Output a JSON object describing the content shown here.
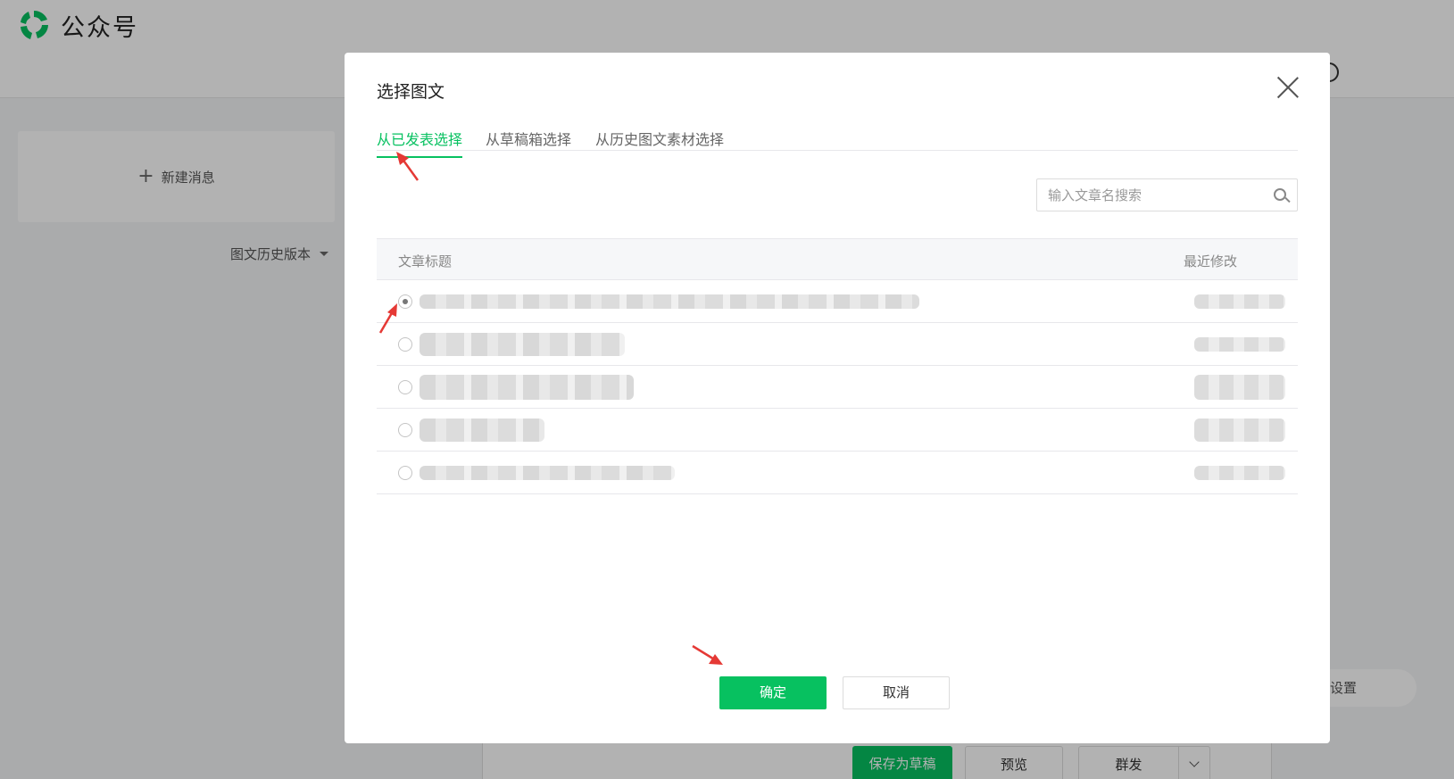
{
  "app": {
    "name": "公众号",
    "brand_color": "#07c160"
  },
  "sidebar": {
    "new_message_label": "新建消息",
    "history_version_label": "图文历史版本"
  },
  "background_actions": {
    "settings_label": "设置",
    "save_draft_label": "保存为草稿",
    "preview_label": "预览",
    "send_label": "群发"
  },
  "dialog": {
    "title": "选择图文",
    "tabs": [
      {
        "label": "从已发表选择",
        "active": true
      },
      {
        "label": "从草稿箱选择",
        "active": false
      },
      {
        "label": "从历史图文素材选择",
        "active": false
      }
    ],
    "search": {
      "placeholder": "输入文章名搜索",
      "value": ""
    },
    "table": {
      "columns": [
        "文章标题",
        "最近修改"
      ],
      "rows": [
        {
          "selected": true,
          "title": "",
          "modified": ""
        },
        {
          "selected": false,
          "title": "",
          "modified": ""
        },
        {
          "selected": false,
          "title": "",
          "modified": ""
        },
        {
          "selected": false,
          "title": "",
          "modified": ""
        },
        {
          "selected": false,
          "title": "",
          "modified": ""
        }
      ]
    },
    "confirm_label": "确定",
    "cancel_label": "取消"
  }
}
